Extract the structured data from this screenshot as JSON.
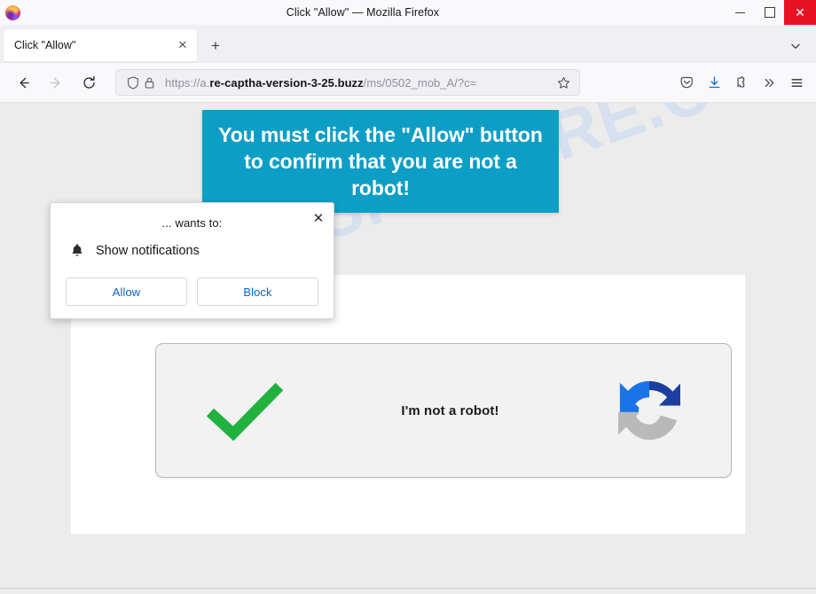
{
  "window": {
    "title": "Click \"Allow\" — Mozilla Firefox",
    "logo_icon": "firefox-logo",
    "controls": {
      "minimize": "minimize-icon",
      "maximize": "maximize-icon",
      "close": "close-icon",
      "close_glyph": "✕"
    }
  },
  "tabs": {
    "items": [
      {
        "label": "Click \"Allow\"",
        "close_glyph": "✕",
        "active": true
      }
    ],
    "new_tab_glyph": "+",
    "list_all_tabs_icon": "chevron-down-icon"
  },
  "toolbar": {
    "back_icon": "back-arrow-icon",
    "forward_icon": "forward-arrow-icon",
    "reload_icon": "reload-icon",
    "shield_icon": "shield-icon",
    "lock_icon": "padlock-icon",
    "bookmark_star_icon": "star-icon",
    "url": {
      "prefix": "https://a.",
      "host": "re-captha-version-3-25.buzz",
      "path": "/ms/0502_mob_A/?c="
    },
    "right_icons": [
      {
        "name": "pocket-save-icon"
      },
      {
        "name": "downloads-icon"
      },
      {
        "name": "extensions-puzzle-icon"
      },
      {
        "name": "overflow-chevrons-icon",
        "glyph": "»"
      },
      {
        "name": "app-menu-hamburger-icon"
      }
    ]
  },
  "page": {
    "watermark_text": "MYANTISPYWARE.COM",
    "banner": {
      "text": "You must click the \"Allow\" button to confirm that you are not a robot!",
      "background_color": "#0d9ec6",
      "text_color": "#ffffff"
    },
    "captcha": {
      "label": "I'm not a robot!",
      "check_icon": "green-checkmark-icon",
      "check_color": "#21b13e",
      "logo_icon": "recaptcha-logo-icon",
      "logo_colors": {
        "light_blue": "#1a73e8",
        "dark_blue": "#1b3fa0",
        "gray": "#b9b9b9"
      }
    }
  },
  "permission_popup": {
    "header": "... wants to:",
    "bell_icon": "bell-icon",
    "request_label": "Show notifications",
    "close_glyph": "✕",
    "close_icon": "close-icon",
    "allow_label": "Allow",
    "block_label": "Block",
    "button_text_color": "#0a66c2"
  }
}
